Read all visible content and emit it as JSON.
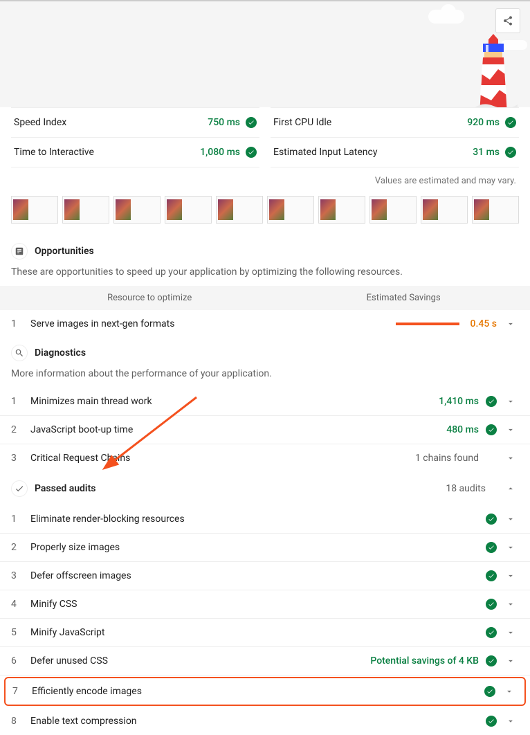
{
  "metrics": {
    "left": [
      {
        "label": "Speed Index",
        "value": "750 ms"
      },
      {
        "label": "Time to Interactive",
        "value": "1,080 ms"
      }
    ],
    "right": [
      {
        "label": "First CPU Idle",
        "value": "920 ms"
      },
      {
        "label": "Estimated Input Latency",
        "value": "31 ms"
      }
    ]
  },
  "estimateNote": "Values are estimated and may vary.",
  "opportunities": {
    "title": "Opportunities",
    "desc": "These are opportunities to speed up your application by optimizing the following resources.",
    "colResource": "Resource to optimize",
    "colSavings": "Estimated Savings",
    "items": [
      {
        "num": "1",
        "title": "Serve images in next-gen formats",
        "value": "0.45 s"
      }
    ]
  },
  "diagnostics": {
    "title": "Diagnostics",
    "desc": "More information about the performance of your application.",
    "items": [
      {
        "num": "1",
        "title": "Minimizes main thread work",
        "value": "1,410 ms",
        "check": true
      },
      {
        "num": "2",
        "title": "JavaScript boot-up time",
        "value": "480 ms",
        "check": true
      },
      {
        "num": "3",
        "title": "Critical Request Chains",
        "value": "1 chains found",
        "gray": true
      }
    ]
  },
  "passed": {
    "title": "Passed audits",
    "count": "18 audits",
    "items": [
      {
        "num": "1",
        "title": "Eliminate render-blocking resources"
      },
      {
        "num": "2",
        "title": "Properly size images"
      },
      {
        "num": "3",
        "title": "Defer offscreen images"
      },
      {
        "num": "4",
        "title": "Minify CSS"
      },
      {
        "num": "5",
        "title": "Minify JavaScript"
      },
      {
        "num": "6",
        "title": "Defer unused CSS",
        "value": "Potential savings of 4 KB"
      },
      {
        "num": "7",
        "title": "Efficiently encode images",
        "highlight": true
      },
      {
        "num": "8",
        "title": "Enable text compression"
      }
    ]
  }
}
